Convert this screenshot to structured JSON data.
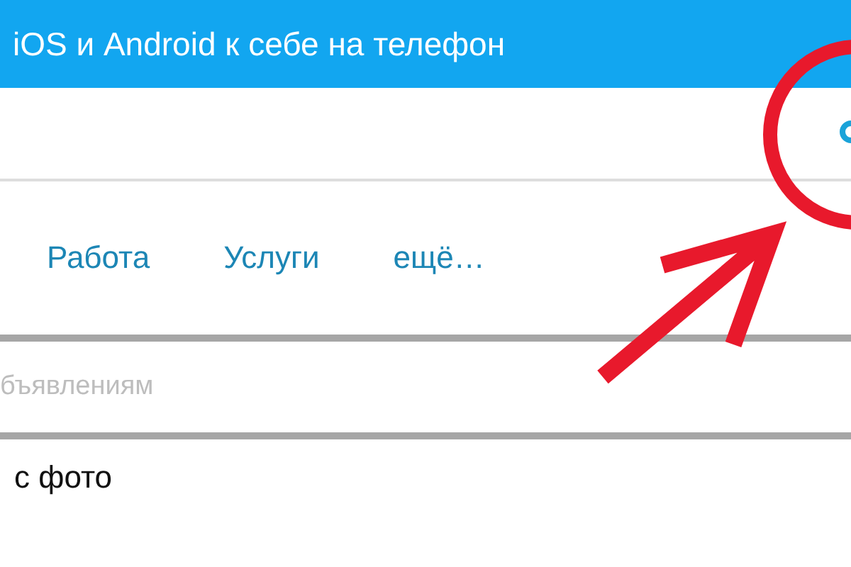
{
  "header": {
    "title": "iOS и Android к себе на телефон"
  },
  "nav": [
    {
      "label": "Работа"
    },
    {
      "label": "Услуги"
    },
    {
      "label": "ещё…"
    }
  ],
  "search": {
    "placeholder": "бъявлениям"
  },
  "filter": {
    "label": "с фото"
  },
  "annotation": {
    "kind": "circle-arrow"
  }
}
